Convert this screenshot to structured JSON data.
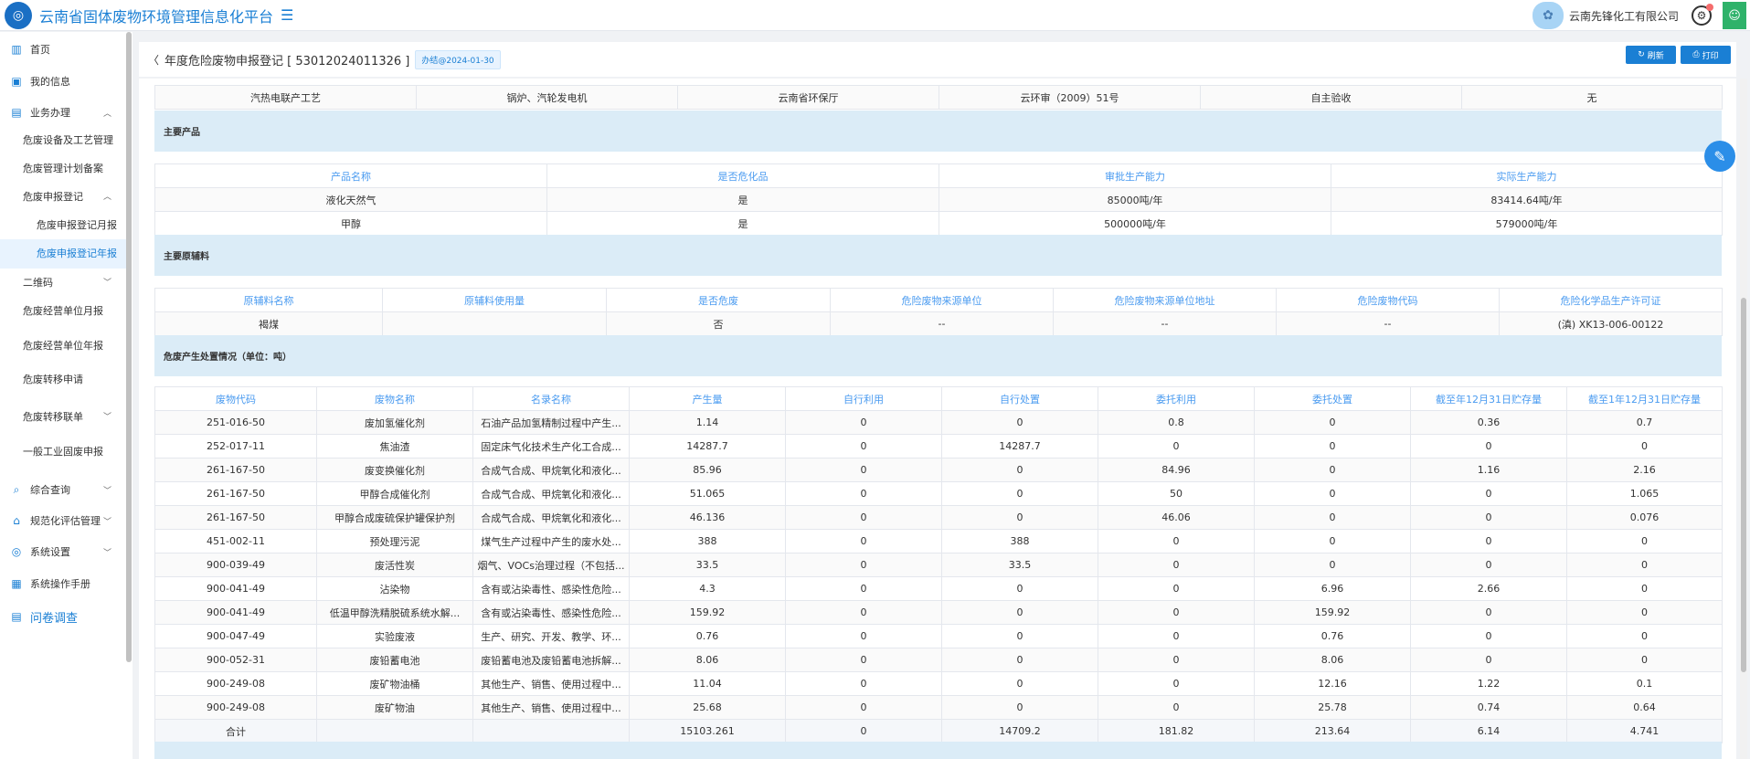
{
  "header": {
    "app_title": "云南省固体废物环境管理信息化平台",
    "company": "云南先锋化工有限公司"
  },
  "sidebar": {
    "items": [
      {
        "label": "首页",
        "icon": "chart-icon"
      },
      {
        "label": "我的信息",
        "icon": "id-card-icon"
      },
      {
        "label": "业务办理",
        "icon": "document-icon"
      },
      {
        "label": "危废设备及工艺管理"
      },
      {
        "label": "危废管理计划备案"
      },
      {
        "label": "危废申报登记"
      },
      {
        "label": "危废申报登记月报"
      },
      {
        "label": "危废申报登记年报"
      },
      {
        "label": "二维码"
      },
      {
        "label": "危废经营单位月报"
      },
      {
        "label": "危废经营单位年报"
      },
      {
        "label": "危废转移申请"
      },
      {
        "label": "危废转移联单"
      },
      {
        "label": "一般工业固废申报"
      },
      {
        "label": "综合查询",
        "icon": "search-doc-icon"
      },
      {
        "label": "规范化评估管理",
        "icon": "home-icon"
      },
      {
        "label": "系统设置",
        "icon": "target-icon"
      },
      {
        "label": "系统操作手册",
        "icon": "manual-icon"
      },
      {
        "label": "问卷调查",
        "icon": "survey-icon"
      }
    ]
  },
  "page": {
    "title": "年度危险废物申报登记 [ 53012024011326 ]",
    "date_badge": "办结@2024-01-30",
    "refresh_label": "刷新",
    "print_label": "打印"
  },
  "top_row": [
    "汽热电联产工艺",
    "锅炉、汽轮发电机",
    "云南省环保厅",
    "云环审（2009）51号",
    "自主验收",
    "无"
  ],
  "products": {
    "section_title": "主要产品",
    "headers": [
      "产品名称",
      "是否危化品",
      "审批生产能力",
      "实际生产能力"
    ],
    "rows": [
      [
        "液化天然气",
        "是",
        "85000吨/年",
        "83414.64吨/年"
      ],
      [
        "甲醇",
        "是",
        "500000吨/年",
        "579000吨/年"
      ]
    ]
  },
  "materials": {
    "section_title": "主要原辅料",
    "headers": [
      "原辅料名称",
      "原辅料使用量",
      "是否危废",
      "危险废物来源单位",
      "危险废物来源单位地址",
      "危险废物代码",
      "危险化学品生产许可证"
    ],
    "rows": [
      [
        "褐煤",
        "",
        "否",
        "--",
        "--",
        "--",
        "(滇) XK13-006-00122"
      ]
    ]
  },
  "waste": {
    "section_title": "危废产生处置情况（单位：吨）",
    "headers": [
      "废物代码",
      "废物名称",
      "名录名称",
      "产生量",
      "自行利用",
      "自行处置",
      "委托利用",
      "委托处置",
      "截至年12月31日贮存量",
      "截至1年12月31日贮存量"
    ],
    "rows": [
      [
        "251-016-50",
        "废加氢催化剂",
        "石油产品加氢精制过程中产生...",
        "1.14",
        "0",
        "0",
        "0.8",
        "0",
        "0.36",
        "0.7"
      ],
      [
        "252-017-11",
        "焦油渣",
        "固定床气化技术生产化工合成...",
        "14287.7",
        "0",
        "14287.7",
        "0",
        "0",
        "0",
        "0"
      ],
      [
        "261-167-50",
        "废变换催化剂",
        "合成气合成、甲烷氧化和液化...",
        "85.96",
        "0",
        "0",
        "84.96",
        "0",
        "1.16",
        "2.16"
      ],
      [
        "261-167-50",
        "甲醇合成催化剂",
        "合成气合成、甲烷氧化和液化...",
        "51.065",
        "0",
        "0",
        "50",
        "0",
        "0",
        "1.065"
      ],
      [
        "261-167-50",
        "甲醇合成废硫保护罐保护剂",
        "合成气合成、甲烷氧化和液化...",
        "46.136",
        "0",
        "0",
        "46.06",
        "0",
        "0",
        "0.076"
      ],
      [
        "451-002-11",
        "预处理污泥",
        "煤气生产过程中产生的废水处...",
        "388",
        "0",
        "388",
        "0",
        "0",
        "0",
        "0"
      ],
      [
        "900-039-49",
        "废活性炭",
        "烟气、VOCs治理过程（不包括...",
        "33.5",
        "0",
        "33.5",
        "0",
        "0",
        "0",
        "0"
      ],
      [
        "900-041-49",
        "沾染物",
        "含有或沾染毒性、感染性危险...",
        "4.3",
        "0",
        "0",
        "0",
        "6.96",
        "2.66",
        "0"
      ],
      [
        "900-041-49",
        "低温甲醇洗精脱硫系统水解...",
        "含有或沾染毒性、感染性危险...",
        "159.92",
        "0",
        "0",
        "0",
        "159.92",
        "0",
        "0"
      ],
      [
        "900-047-49",
        "实验废液",
        "生产、研究、开发、教学、环...",
        "0.76",
        "0",
        "0",
        "0",
        "0.76",
        "0",
        "0"
      ],
      [
        "900-052-31",
        "废铅蓄电池",
        "废铅蓄电池及废铅蓄电池拆解...",
        "8.06",
        "0",
        "0",
        "0",
        "8.06",
        "0",
        "0"
      ],
      [
        "900-249-08",
        "废矿物油桶",
        "其他生产、销售、使用过程中...",
        "11.04",
        "0",
        "0",
        "0",
        "12.16",
        "1.22",
        "0.1"
      ],
      [
        "900-249-08",
        "废矿物油",
        "其他生产、销售、使用过程中...",
        "25.68",
        "0",
        "0",
        "0",
        "25.78",
        "0.74",
        "0.64"
      ]
    ],
    "total": [
      "合计",
      "",
      "",
      "15103.261",
      "0",
      "14709.2",
      "181.82",
      "213.64",
      "6.14",
      "4.741"
    ]
  }
}
